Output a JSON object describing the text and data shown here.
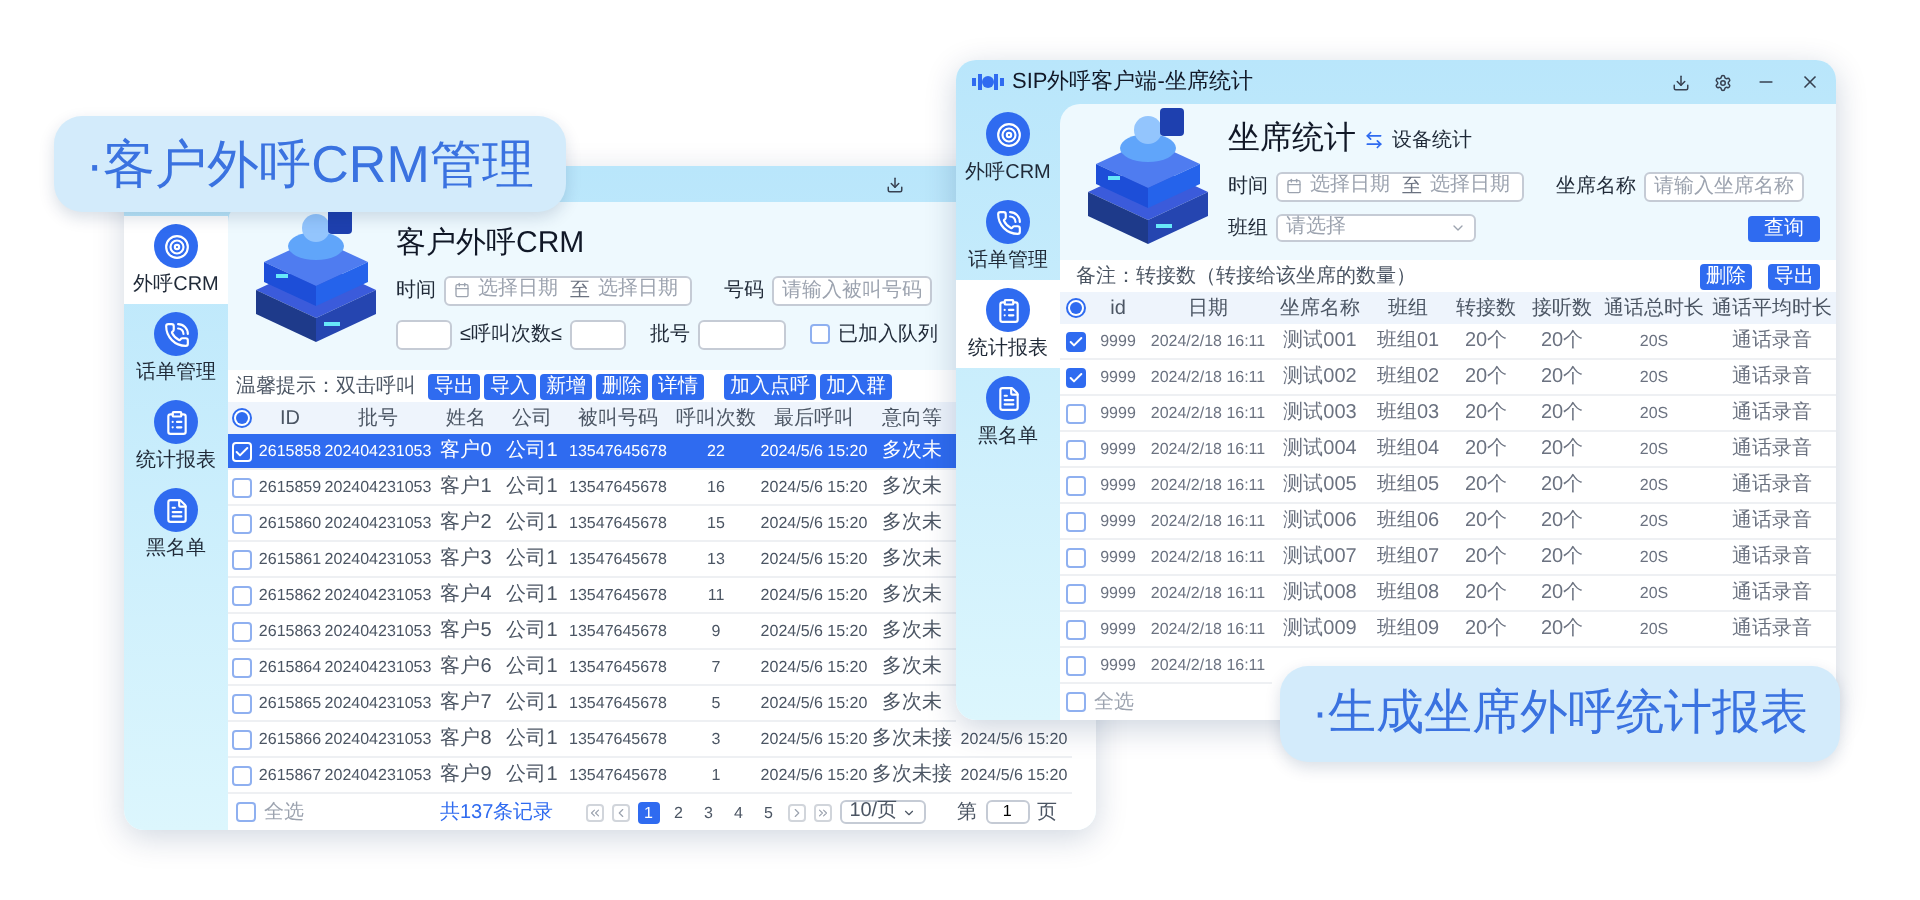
{
  "captions": [
    "·客户外呼CRM管理",
    "·生成坐席外呼统计报表"
  ],
  "crm_window": {
    "sidebar": [
      {
        "label": "外呼CRM",
        "selected": true
      },
      {
        "label": "话单管理",
        "selected": false
      },
      {
        "label": "统计报表",
        "selected": false
      },
      {
        "label": "黑名单",
        "selected": false
      }
    ],
    "title": "客户外呼CRM",
    "filters": {
      "time_label": "时间",
      "date_from_placeholder": "选择日期",
      "date_sep": "至",
      "date_to_placeholder": "选择日期",
      "number_label": "号码",
      "number_placeholder": "请输入被叫号码",
      "count_label": "≤呼叫次数≤",
      "batch_label": "批号",
      "queued_label": "已加入队列",
      "queued_checked": false
    },
    "tip": "温馨提示：双击呼叫",
    "buttons": [
      "导出",
      "导入",
      "新增",
      "删除",
      "详情"
    ],
    "queue_buttons": [
      "加入点呼",
      "加入群"
    ],
    "table": {
      "header_indeterminate": true,
      "columns": [
        "ID",
        "批号",
        "姓名",
        "公司",
        "被叫号码",
        "呼叫次数",
        "最后呼叫",
        "意向等"
      ],
      "rows": [
        {
          "selected": true,
          "cells": [
            "2615858",
            "202404231053",
            "客户0",
            "公司1",
            "13547645678",
            "22",
            "2024/5/6 15:20",
            "多次未"
          ]
        },
        {
          "selected": false,
          "cells": [
            "2615859",
            "202404231053",
            "客户1",
            "公司1",
            "13547645678",
            "16",
            "2024/5/6 15:20",
            "多次未"
          ]
        },
        {
          "selected": false,
          "cells": [
            "2615860",
            "202404231053",
            "客户2",
            "公司1",
            "13547645678",
            "15",
            "2024/5/6 15:20",
            "多次未"
          ]
        },
        {
          "selected": false,
          "cells": [
            "2615861",
            "202404231053",
            "客户3",
            "公司1",
            "13547645678",
            "13",
            "2024/5/6 15:20",
            "多次未"
          ]
        },
        {
          "selected": false,
          "cells": [
            "2615862",
            "202404231053",
            "客户4",
            "公司1",
            "13547645678",
            "11",
            "2024/5/6 15:20",
            "多次未"
          ]
        },
        {
          "selected": false,
          "cells": [
            "2615863",
            "202404231053",
            "客户5",
            "公司1",
            "13547645678",
            "9",
            "2024/5/6 15:20",
            "多次未"
          ]
        },
        {
          "selected": false,
          "cells": [
            "2615864",
            "202404231053",
            "客户6",
            "公司1",
            "13547645678",
            "7",
            "2024/5/6 15:20",
            "多次未"
          ]
        },
        {
          "selected": false,
          "cells": [
            "2615865",
            "202404231053",
            "客户7",
            "公司1",
            "13547645678",
            "5",
            "2024/5/6 15:20",
            "多次未"
          ]
        },
        {
          "selected": false,
          "cells": [
            "2615866",
            "202404231053",
            "客户8",
            "公司1",
            "13547645678",
            "3",
            "2024/5/6 15:20",
            "多次未接",
            "2024/5/6 15:20"
          ]
        },
        {
          "selected": false,
          "cells": [
            "2615867",
            "202404231053",
            "客户9",
            "公司1",
            "13547645678",
            "1",
            "2024/5/6 15:20",
            "多次未接",
            "2024/5/6 15:20"
          ]
        }
      ]
    },
    "footer": {
      "select_all_label": "全选",
      "select_all_checked": false,
      "total": "共137条记录",
      "pages": [
        {
          "label": "1",
          "selected": true
        },
        {
          "label": "2",
          "selected": false
        },
        {
          "label": "3",
          "selected": false
        },
        {
          "label": "4",
          "selected": false
        },
        {
          "label": "5",
          "selected": false
        }
      ],
      "page_size": "10/页",
      "goto_prefix": "第",
      "goto_value": "1",
      "goto_suffix": "页"
    }
  },
  "stats_window": {
    "title": "SIP外呼客户端-坐席统计",
    "sidebar": [
      {
        "label": "外呼CRM",
        "selected": false
      },
      {
        "label": "话单管理",
        "selected": false
      },
      {
        "label": "统计报表",
        "selected": true
      },
      {
        "label": "黑名单",
        "selected": false
      }
    ],
    "heading": "坐席统计",
    "switch_label": "设备统计",
    "filters": {
      "time_label": "时间",
      "date_from_placeholder": "选择日期",
      "date_sep": "至",
      "date_to_placeholder": "选择日期",
      "agent_label": "坐席名称",
      "agent_placeholder": "请输入坐席名称",
      "group_label": "班组",
      "group_placeholder": "请选择"
    },
    "query_button": "查询",
    "note": "备注：转接数（转接给该坐席的数量）",
    "buttons": [
      "删除",
      "导出"
    ],
    "table": {
      "header_indeterminate": true,
      "columns": [
        "id",
        "日期",
        "坐席名称",
        "班组",
        "转接数",
        "接听数",
        "通话总时长",
        "通话平均时长"
      ],
      "rows": [
        {
          "selected": true,
          "cells": [
            "9999",
            "2024/2/18 16:11",
            "测试001",
            "班组01",
            "20个",
            "20个",
            "20S",
            "通话录音"
          ]
        },
        {
          "selected": true,
          "cells": [
            "9999",
            "2024/2/18 16:11",
            "测试002",
            "班组02",
            "20个",
            "20个",
            "20S",
            "通话录音"
          ]
        },
        {
          "selected": false,
          "cells": [
            "9999",
            "2024/2/18 16:11",
            "测试003",
            "班组03",
            "20个",
            "20个",
            "20S",
            "通话录音"
          ]
        },
        {
          "selected": false,
          "cells": [
            "9999",
            "2024/2/18 16:11",
            "测试004",
            "班组04",
            "20个",
            "20个",
            "20S",
            "通话录音"
          ]
        },
        {
          "selected": false,
          "cells": [
            "9999",
            "2024/2/18 16:11",
            "测试005",
            "班组05",
            "20个",
            "20个",
            "20S",
            "通话录音"
          ]
        },
        {
          "selected": false,
          "cells": [
            "9999",
            "2024/2/18 16:11",
            "测试006",
            "班组06",
            "20个",
            "20个",
            "20S",
            "通话录音"
          ]
        },
        {
          "selected": false,
          "cells": [
            "9999",
            "2024/2/18 16:11",
            "测试007",
            "班组07",
            "20个",
            "20个",
            "20S",
            "通话录音"
          ]
        },
        {
          "selected": false,
          "cells": [
            "9999",
            "2024/2/18 16:11",
            "测试008",
            "班组08",
            "20个",
            "20个",
            "20S",
            "通话录音"
          ]
        },
        {
          "selected": false,
          "cells": [
            "9999",
            "2024/2/18 16:11",
            "测试009",
            "班组09",
            "20个",
            "20个",
            "20S",
            "通话录音"
          ]
        },
        {
          "selected": false,
          "cells": [
            "9999",
            "2024/2/18 16:11"
          ]
        }
      ]
    },
    "footer": {
      "select_all_label": "全选",
      "select_all_checked": false
    }
  }
}
